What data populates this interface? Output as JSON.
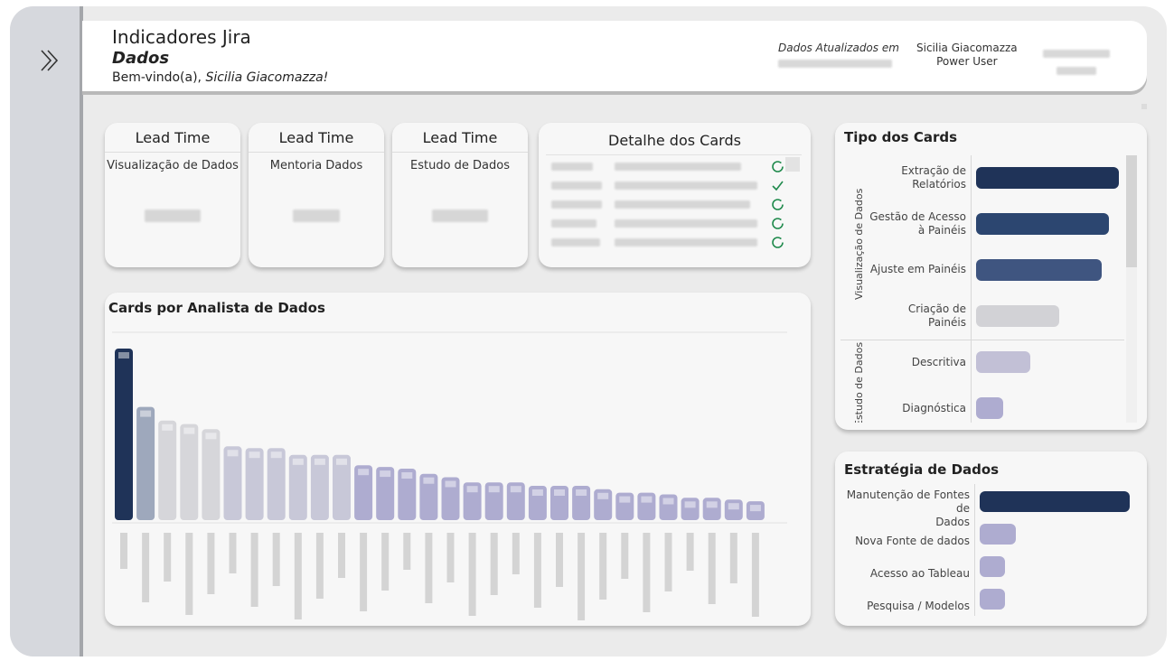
{
  "header": {
    "title": "Indicadores Jira",
    "subtitle": "Dados",
    "welcome_prefix": "Bem-vindo(a), ",
    "welcome_name": "Sicilia Giacomazza!",
    "updated_label": "Dados Atualizados em",
    "user_name": "Sicilia Giacomazza",
    "user_role": "Power User"
  },
  "lead_time_cards": [
    {
      "title": "Lead Time",
      "name": "Visualização de Dados"
    },
    {
      "title": "Lead Time",
      "name": "Mentoria Dados"
    },
    {
      "title": "Lead Time",
      "name": "Estudo de Dados"
    }
  ],
  "details": {
    "title": "Detalhe dos Cards",
    "rows": [
      {
        "status_icon": "progress-circle-icon"
      },
      {
        "status_icon": "check-icon"
      },
      {
        "status_icon": "progress-circle-icon"
      },
      {
        "status_icon": "progress-circle-icon"
      },
      {
        "status_icon": "progress-circle-icon"
      }
    ]
  },
  "analyst_chart": {
    "title": "Cards por Analista de Dados",
    "colors": {
      "top": "#1f3358",
      "second": "#9ea8bc",
      "light": "#d6d6da",
      "mid": "#c8c8d8",
      "base": "#aeacd0"
    }
  },
  "chart_data": [
    {
      "type": "bar",
      "title": "Cards por Analista de Dados",
      "values": [
        100,
        66,
        58,
        56,
        53,
        43,
        42,
        42,
        38,
        38,
        38,
        32,
        31,
        30,
        27,
        25,
        22,
        22,
        22,
        20,
        20,
        20,
        18,
        16,
        16,
        15,
        13,
        13,
        12,
        11
      ],
      "note_values_relative": true
    },
    {
      "type": "bar",
      "orientation": "horizontal",
      "title": "Tipo dos Cards",
      "groups": [
        {
          "label": "Visualização de Dados",
          "categories": [
            "Extração de Relatórios",
            "Gestão de Acesso à Painéis",
            "Ajuste em Painéis",
            "Criação de Painéis"
          ],
          "values": [
            100,
            93,
            88,
            58
          ]
        },
        {
          "label": "Estudo de Dados",
          "categories": [
            "Descritiva",
            "Diagnóstica"
          ],
          "values": [
            38,
            19
          ]
        }
      ]
    },
    {
      "type": "bar",
      "orientation": "horizontal",
      "title": "Estratégia de Dados",
      "categories": [
        "Manutenção de Fontes de Dados",
        "Nova Fonte de dados",
        "Acesso ao Tableau",
        "Pesquisa / Modelos"
      ],
      "values": [
        100,
        24,
        17,
        17
      ]
    }
  ],
  "tipo_cards": {
    "title": "Tipo dos Cards",
    "group1": "Visualização de Dados",
    "group2": "Estudo de Dados",
    "cat1a": "Extração de",
    "cat1b": "Relatórios",
    "cat2a": "Gestão de Acesso",
    "cat2b": "à Painéis",
    "cat3": "Ajuste em Painéis",
    "cat4a": "Criação de",
    "cat4b": "Painéis",
    "cat5": "Descritiva",
    "cat6": "Diagnóstica",
    "colors": [
      "#1f3358",
      "#2c4670",
      "#3f5580",
      "#d2d2d6",
      "#c2c0d6",
      "#aeacd0"
    ]
  },
  "estrategia": {
    "title": "Estratégia de Dados",
    "cat1a": "Manutenção de Fontes de",
    "cat1b": "Dados",
    "cat2": "Nova Fonte de dados",
    "cat3": "Acesso ao Tableau",
    "cat4": "Pesquisa / Modelos",
    "colors": [
      "#1f3358",
      "#aeacd0",
      "#aeacd0",
      "#aeacd0"
    ]
  }
}
